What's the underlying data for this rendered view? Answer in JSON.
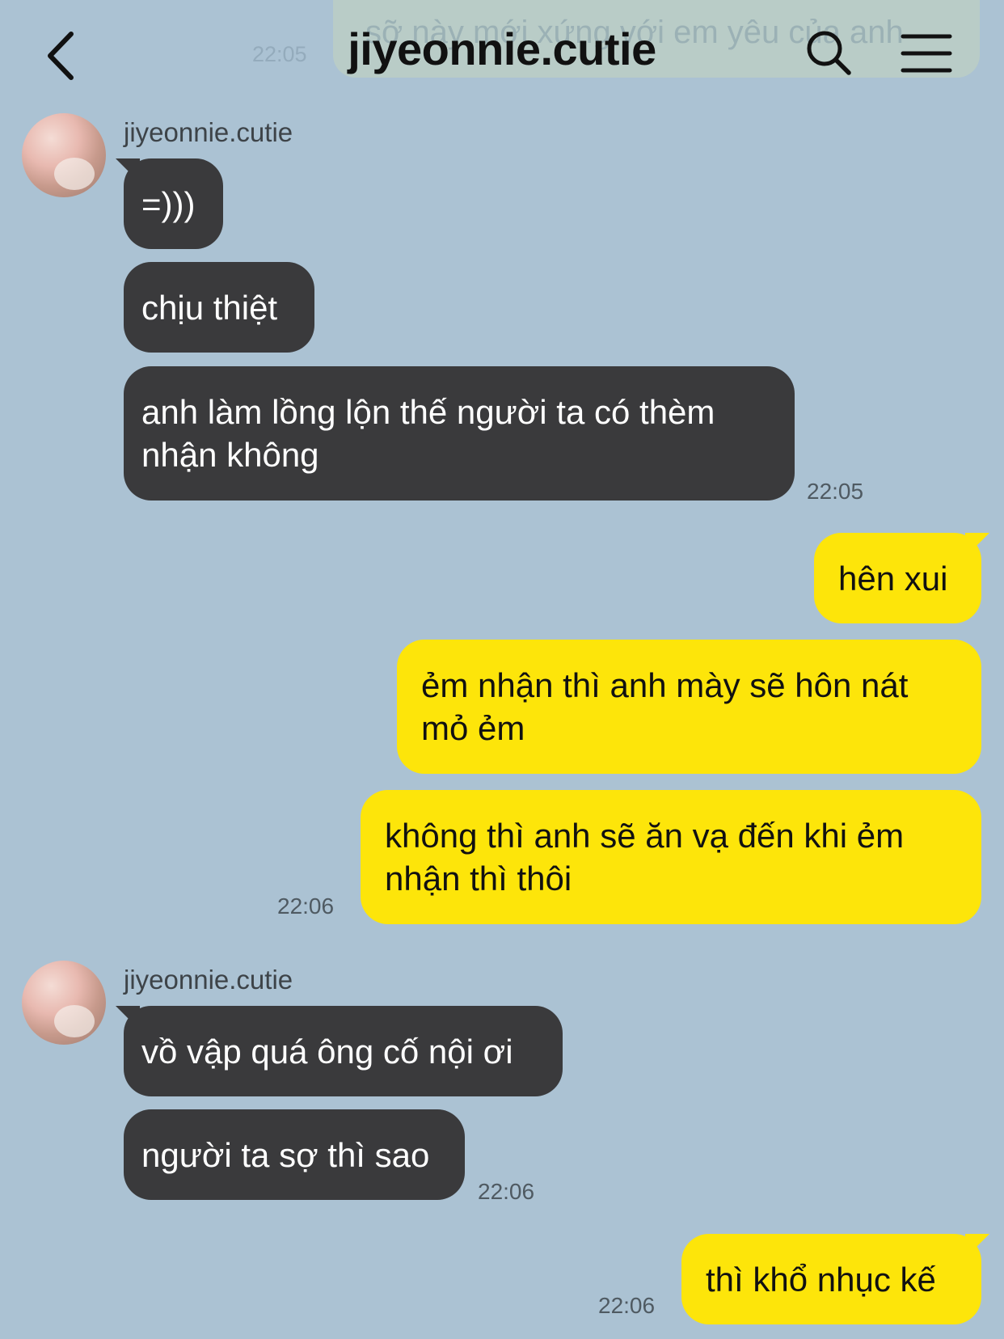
{
  "header": {
    "ghost_text": "sỡ này mới xứng với em yêu của anh",
    "ghost_time": "22:05",
    "title": "jiyeonnie.cutie"
  },
  "messages": [
    {
      "sender": "jiyeonnie.cutie",
      "text": "=)))"
    },
    {
      "text": "chịu thiệt"
    },
    {
      "text": "anh làm lồng lộn thế người ta có thèm nhận không",
      "time": "22:05"
    },
    {
      "text": "hên xui"
    },
    {
      "text": "ẻm nhận thì anh mày sẽ hôn nát mỏ ẻm"
    },
    {
      "text": "không thì anh sẽ ăn vạ đến khi ẻm nhận thì thôi",
      "time": "22:06"
    },
    {
      "sender": "jiyeonnie.cutie",
      "text": "vồ vập quá ông cố nội ơi"
    },
    {
      "text": "người ta sợ thì sao",
      "time": "22:06"
    },
    {
      "text": "thì khổ nhục kế",
      "time": "22:06"
    }
  ]
}
